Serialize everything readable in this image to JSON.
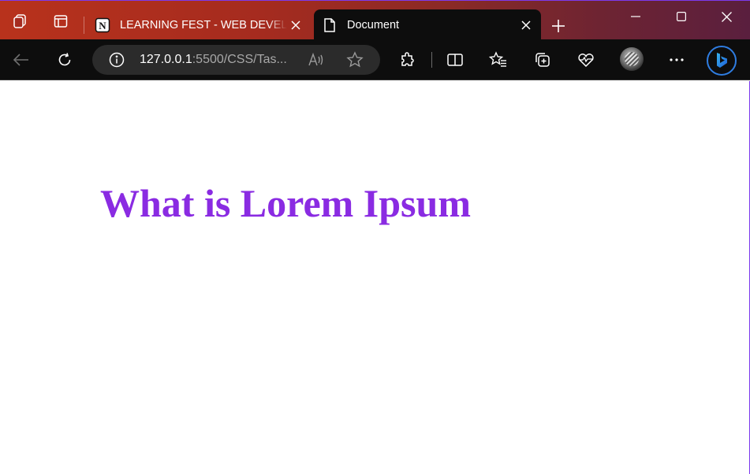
{
  "browser": {
    "tabs": [
      {
        "title": "LEARNING FEST - WEB DEVELOPMENT",
        "favicon": "notion-icon",
        "active": false
      },
      {
        "title": "Document",
        "favicon": "document-icon",
        "active": true
      }
    ],
    "address": {
      "host": "127.0.0.1",
      "path": ":5500/CSS/Tas..."
    },
    "colors": {
      "titlebar": "#a52b1f",
      "toolbar": "#0d0d0d",
      "addressbar": "#2b2b2b",
      "accent": "#2f7de1"
    }
  },
  "page": {
    "heading": "What is Lorem Ipsum",
    "heading_color": "#8a2be2"
  }
}
